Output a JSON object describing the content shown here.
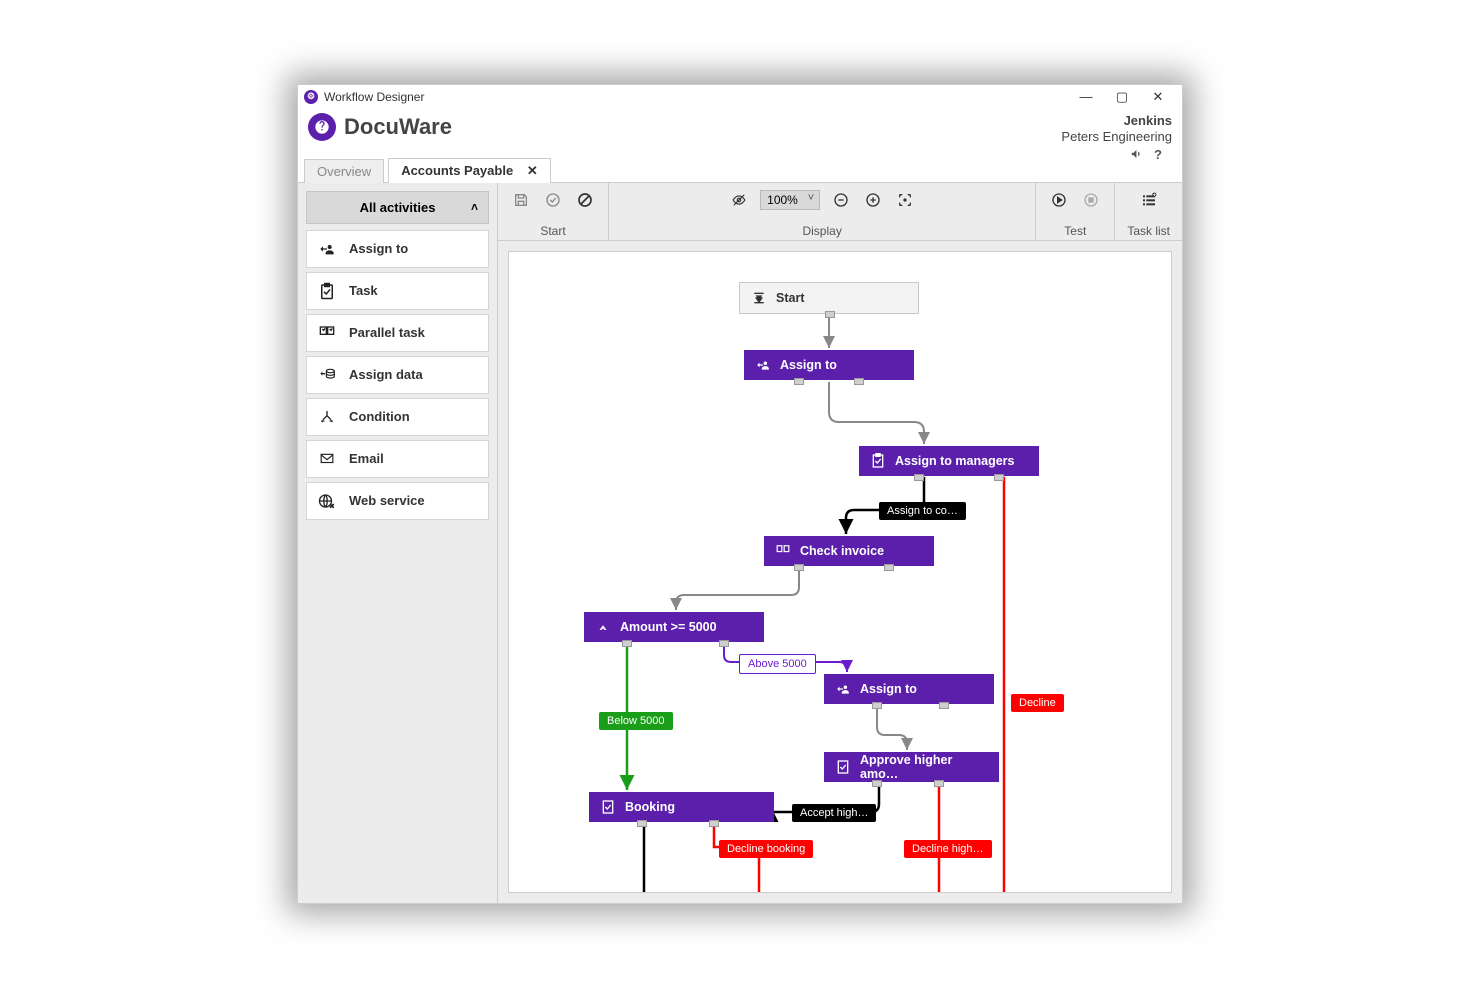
{
  "window": {
    "title": "Workflow Designer",
    "minimize": "—",
    "maximize": "▢",
    "close": "✕"
  },
  "brand": {
    "name": "DocuWare"
  },
  "user": {
    "name": "Jenkins",
    "org": "Peters Engineering"
  },
  "header_icons": {
    "announce": "📣",
    "help": "?"
  },
  "tabs": {
    "overview": "Overview",
    "active": "Accounts Payable",
    "close_glyph": "✕"
  },
  "sidebar": {
    "header": "All activities",
    "items": [
      {
        "label": "Assign to"
      },
      {
        "label": "Task"
      },
      {
        "label": "Parallel task"
      },
      {
        "label": "Assign data"
      },
      {
        "label": "Condition"
      },
      {
        "label": "Email"
      },
      {
        "label": "Web service"
      }
    ]
  },
  "toolbar": {
    "start": {
      "label": "Start"
    },
    "display": {
      "label": "Display",
      "zoom": "100%"
    },
    "test": {
      "label": "Test"
    },
    "tasklist": {
      "label": "Task list"
    }
  },
  "nodes": {
    "start": "Start",
    "assign1": "Assign to",
    "managers": "Assign to managers",
    "check": "Check invoice",
    "amount": "Amount >= 5000",
    "assign2": "Assign to",
    "approve": "Approve higher amo…",
    "booking": "Booking"
  },
  "edge_labels": {
    "assign_co": "Assign to co…",
    "below": "Below 5000",
    "above": "Above 5000",
    "accept_high": "Accept high…",
    "decline": "Decline",
    "decline_booking": "Decline booking",
    "decline_high": "Decline high…"
  }
}
